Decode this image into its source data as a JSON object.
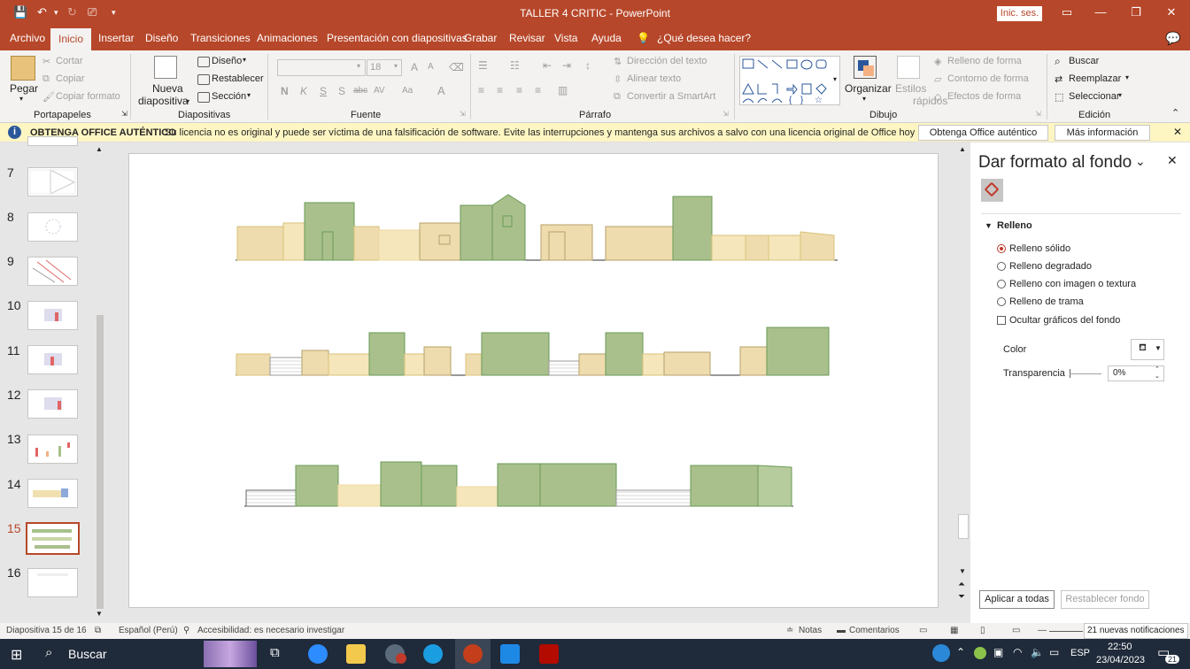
{
  "app": {
    "window_title": "TALLER 4 CRITIC  -  PowerPoint",
    "sign_in": "Inic. ses."
  },
  "tabs": [
    "Archivo",
    "Inicio",
    "Insertar",
    "Diseño",
    "Transiciones",
    "Animaciones",
    "Presentación con diapositivas",
    "Grabar",
    "Revisar",
    "Vista",
    "Ayuda"
  ],
  "tell_me": "¿Qué desea hacer?",
  "ribbon": {
    "clipboard": {
      "paste": "Pegar",
      "cut": "Cortar",
      "copy": "Copiar",
      "format_painter": "Copiar formato",
      "group": "Portapapeles"
    },
    "slides": {
      "new_slide_1": "Nueva",
      "new_slide_2": "diapositiva",
      "layout": "Diseño",
      "reset": "Restablecer",
      "section": "Sección",
      "group": "Diapositivas"
    },
    "font": {
      "size": "18",
      "bold": "N",
      "italic": "K",
      "underline": "S",
      "shadow": "S",
      "strike": "abc",
      "spacing": "AV",
      "case": "Aa",
      "color": "A",
      "group": "Fuente"
    },
    "paragraph": {
      "text_direction": "Dirección del texto",
      "align_text": "Alinear texto",
      "smartart": "Convertir a SmartArt",
      "group": "Párrafo"
    },
    "drawing": {
      "arrange": "Organizar",
      "quick_styles_1": "Estilos",
      "quick_styles_2": "rápidos",
      "shape_fill": "Relleno de forma",
      "shape_outline": "Contorno de forma",
      "shape_effects": "Efectos de forma",
      "group": "Dibujo"
    },
    "editing": {
      "find": "Buscar",
      "replace": "Reemplazar",
      "select": "Seleccionar",
      "group": "Edición"
    }
  },
  "message_bar": {
    "title": "OBTENGA OFFICE AUTÉNTICO",
    "text": "Su licencia no es original y puede ser víctima de una falsificación de software. Evite las interrupciones y mantenga sus archivos a salvo con una licencia original de Office hoy mismo.",
    "btn_genuine": "Obtenga Office auténtico",
    "btn_more": "Más información"
  },
  "thumbnails": [
    {
      "num": "7"
    },
    {
      "num": "8"
    },
    {
      "num": "9"
    },
    {
      "num": "10"
    },
    {
      "num": "11"
    },
    {
      "num": "12"
    },
    {
      "num": "13"
    },
    {
      "num": "14"
    },
    {
      "num": "15"
    },
    {
      "num": "16"
    }
  ],
  "pane": {
    "title": "Dar formato al fondo",
    "section": "Relleno",
    "options": [
      "Relleno sólido",
      "Relleno degradado",
      "Relleno con imagen o textura",
      "Relleno de trama"
    ],
    "selected_option": 0,
    "hide_bg": "Ocultar gráficos del fondo",
    "color_label": "Color",
    "transparency_label": "Transparencia",
    "transparency_value": "0%",
    "apply_all": "Aplicar a todas",
    "reset_bg": "Restablecer fondo"
  },
  "status": {
    "slide": "Diapositiva 15 de 16",
    "language": "Español (Perú)",
    "accessibility": "Accesibilidad: es necesario investigar",
    "notes": "Notas",
    "comments": "Comentarios",
    "notifications": "21 nuevas notificaciones"
  },
  "taskbar": {
    "search": "Buscar",
    "lang": "ESP",
    "time": "22:50",
    "date": "23/04/2023",
    "badge": "21"
  },
  "colors": {
    "accent": "#b7472a",
    "bg_fill": "#a9c08c",
    "wall_fill": "#f0e0b0"
  }
}
